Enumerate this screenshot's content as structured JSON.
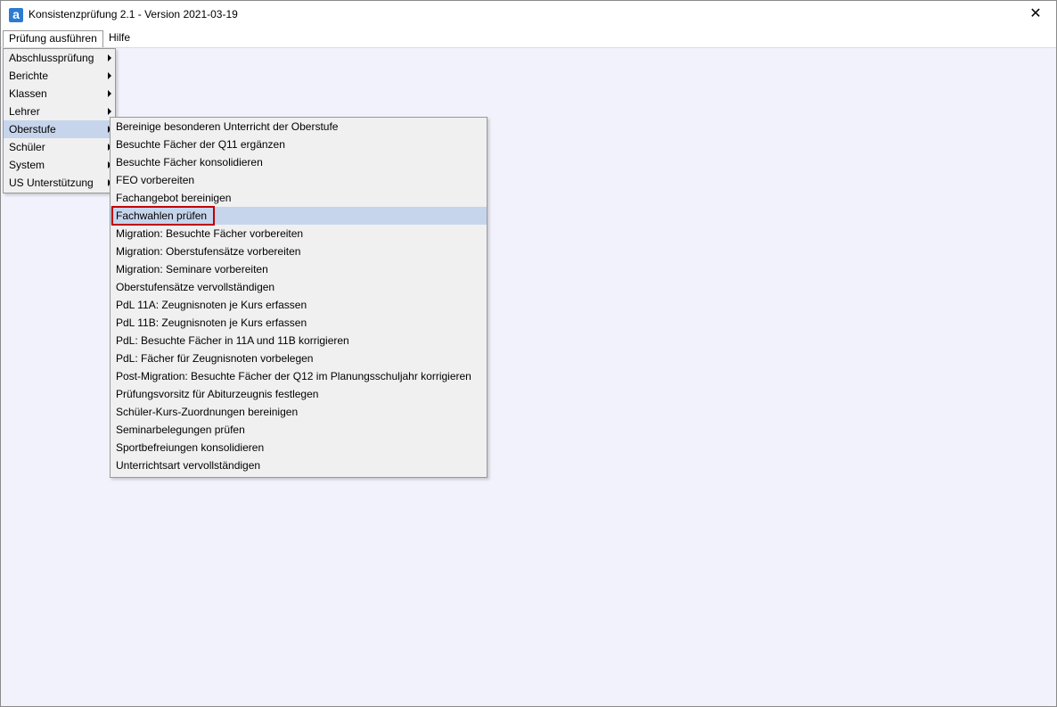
{
  "window": {
    "title": "Konsistenzprüfung 2.1 - Version 2021-03-19",
    "icon_letter": "a",
    "close_glyph": "✕"
  },
  "menubar": {
    "items": [
      {
        "label": "Prüfung ausführen"
      },
      {
        "label": "Hilfe"
      }
    ]
  },
  "main_menu": {
    "items": [
      {
        "label": "Abschlussprüfung",
        "has_submenu": true
      },
      {
        "label": "Berichte",
        "has_submenu": true
      },
      {
        "label": "Klassen",
        "has_submenu": true
      },
      {
        "label": "Lehrer",
        "has_submenu": true
      },
      {
        "label": "Oberstufe",
        "has_submenu": true,
        "selected": true
      },
      {
        "label": "Schüler",
        "has_submenu": true
      },
      {
        "label": "System",
        "has_submenu": true
      },
      {
        "label": "US Unterstützung",
        "has_submenu": true
      }
    ]
  },
  "oberstufe_menu": {
    "items": [
      {
        "label": "Bereinige besonderen Unterricht der Oberstufe"
      },
      {
        "label": "Besuchte Fächer der Q11 ergänzen"
      },
      {
        "label": "Besuchte Fächer konsolidieren"
      },
      {
        "label": "FEO vorbereiten"
      },
      {
        "label": "Fachangebot bereinigen"
      },
      {
        "label": "Fachwahlen prüfen",
        "selected": true
      },
      {
        "label": "Migration: Besuchte Fächer vorbereiten"
      },
      {
        "label": "Migration: Oberstufensätze vorbereiten"
      },
      {
        "label": "Migration: Seminare vorbereiten"
      },
      {
        "label": "Oberstufensätze vervollständigen"
      },
      {
        "label": "PdL 11A: Zeugnisnoten je Kurs erfassen"
      },
      {
        "label": "PdL 11B: Zeugnisnoten je Kurs erfassen"
      },
      {
        "label": "PdL: Besuchte Fächer in 11A und 11B korrigieren"
      },
      {
        "label": "PdL: Fächer für Zeugnisnoten vorbelegen"
      },
      {
        "label": "Post-Migration: Besuchte Fächer der Q12 im Planungsschuljahr korrigieren"
      },
      {
        "label": "Prüfungsvorsitz für Abiturzeugnis festlegen"
      },
      {
        "label": "Schüler-Kurs-Zuordnungen bereinigen"
      },
      {
        "label": "Seminarbelegungen prüfen"
      },
      {
        "label": "Sportbefreiungen konsolidieren"
      },
      {
        "label": "Unterrichtsart vervollständigen"
      }
    ]
  },
  "colors": {
    "client_background": "#f2f2fc",
    "highlight": "#c6d5ec",
    "focus_outline": "#c00000",
    "app_icon": "#2b7bd3"
  }
}
